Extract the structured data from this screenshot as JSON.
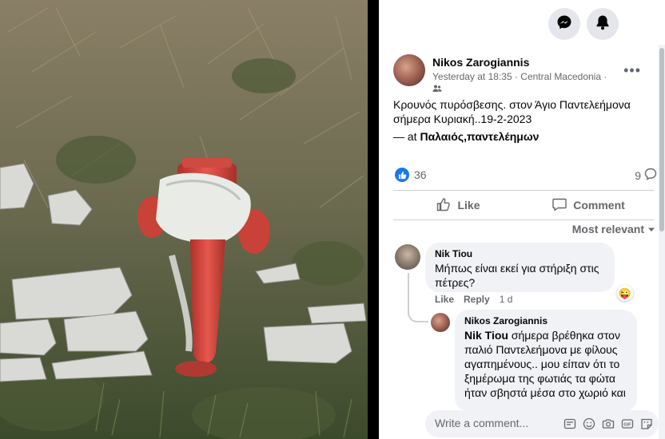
{
  "post": {
    "author": "Nikos Zarogiannis",
    "meta": "Yesterday at 18:35 · Central Macedonia ·",
    "text": "Κρουνός πυρόσβεσης. στον Άγιο Παντελεήμονα σήμερα Κυριακή..19-2-2023",
    "location_prefix": "— at ",
    "location": "Παλαιός,παντελέημων",
    "reaction_count": "36",
    "comment_count": "9",
    "like_label": "Like",
    "comment_label": "Comment"
  },
  "comments": {
    "sort_label": "Most relevant",
    "items": [
      {
        "name": "Nik Tiou",
        "text": "Μήπως είναι εκεί για στήριξη στις πέτρες?",
        "like_label": "Like",
        "reply_label": "Reply",
        "time": "1 d",
        "reaction_emoji": "😜"
      },
      {
        "name": "Nikos Zarogiannis",
        "mention": "Nik Tiou",
        "text": " σήμερα βρέθηκα στον παλιό Παντελεήμονα με φίλους αγαπημένους.. μου είπαν ότι το ξημέρωμα της φωτιάς τα φώτα ήταν σβηστά μέσα στο χωριό και"
      }
    ]
  },
  "composer": {
    "placeholder": "Write a comment..."
  },
  "icons": {
    "topbar": [
      "messenger-icon",
      "notifications-icon"
    ],
    "composer": [
      "sticker-icon",
      "emoji-icon",
      "camera-icon",
      "gif-icon",
      "sticker-square-icon"
    ]
  },
  "colors": {
    "accent": "#1877f2",
    "hydrant": "#d84a3e"
  }
}
